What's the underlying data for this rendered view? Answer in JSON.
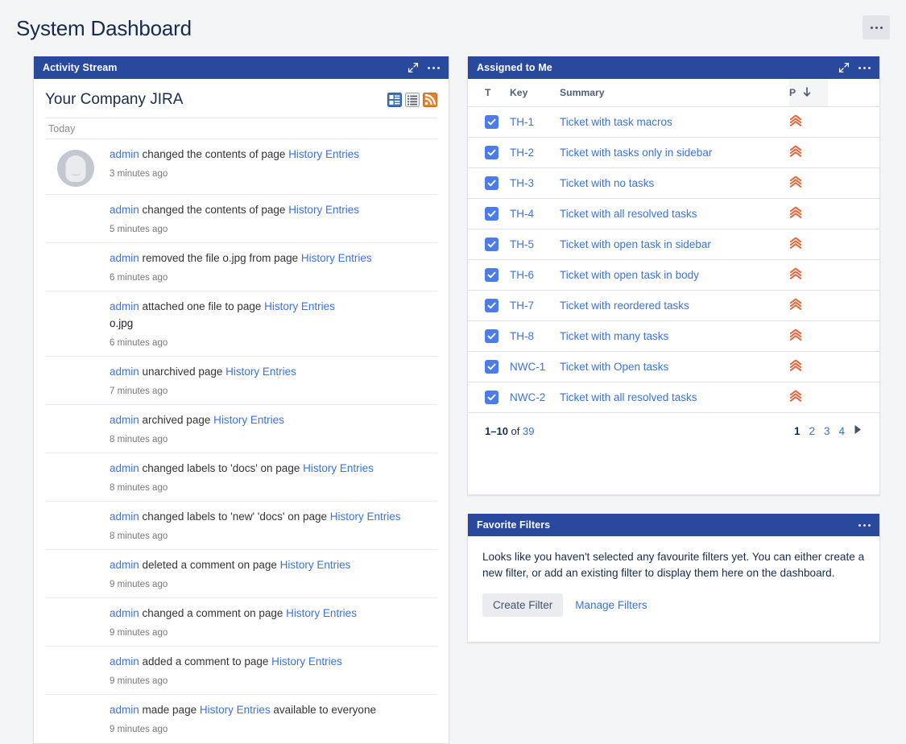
{
  "page": {
    "title": "System Dashboard",
    "menu_icon": "ellipsis-icon"
  },
  "colors": {
    "panel_header_bg": "#28499C",
    "link": "#3B73D6",
    "task_icon": "#4C7CE8",
    "priority_highest": "#E4663A",
    "page_bg": "#F4F5F7",
    "text": "#172B4D"
  },
  "activity_stream": {
    "panel_title": "Activity Stream",
    "expand_icon": "expand-icon",
    "menu_icon": "ellipsis-icon",
    "heading": "Your Company JIRA",
    "view_icons": [
      "detail-view-icon",
      "list-view-icon",
      "rss-feed-icon"
    ],
    "date_group": "Today",
    "entries": [
      {
        "has_avatar": true,
        "actor": "admin",
        "action": " changed the contents of page ",
        "target": "History Entries",
        "suffix": "",
        "attachment": "",
        "time": "3 minutes ago"
      },
      {
        "has_avatar": false,
        "actor": "admin",
        "action": " changed the contents of page ",
        "target": "History Entries",
        "suffix": "",
        "attachment": "",
        "time": "5 minutes ago"
      },
      {
        "has_avatar": false,
        "actor": "admin",
        "action": " removed the file o.jpg from page ",
        "target": "History Entries",
        "suffix": "",
        "attachment": "",
        "time": "6 minutes ago"
      },
      {
        "has_avatar": false,
        "actor": "admin",
        "action": " attached one file to page ",
        "target": "History Entries",
        "suffix": "",
        "attachment": "o.jpg",
        "time": "6 minutes ago"
      },
      {
        "has_avatar": false,
        "actor": "admin",
        "action": " unarchived page ",
        "target": "History Entries",
        "suffix": "",
        "attachment": "",
        "time": "7 minutes ago"
      },
      {
        "has_avatar": false,
        "actor": "admin",
        "action": " archived page ",
        "target": "History Entries",
        "suffix": "",
        "attachment": "",
        "time": "8 minutes ago"
      },
      {
        "has_avatar": false,
        "actor": "admin",
        "action": " changed labels to 'docs'  on page ",
        "target": "History Entries",
        "suffix": "",
        "attachment": "",
        "time": "8 minutes ago"
      },
      {
        "has_avatar": false,
        "actor": "admin",
        "action": " changed labels to 'new'  'docs'  on page ",
        "target": "History Entries",
        "suffix": "",
        "attachment": "",
        "time": "8 minutes ago"
      },
      {
        "has_avatar": false,
        "actor": "admin",
        "action": " deleted a comment on page ",
        "target": "History Entries",
        "suffix": "",
        "attachment": "",
        "time": "9 minutes ago"
      },
      {
        "has_avatar": false,
        "actor": "admin",
        "action": " changed a comment on page ",
        "target": "History Entries",
        "suffix": "",
        "attachment": "",
        "time": "9 minutes ago"
      },
      {
        "has_avatar": false,
        "actor": "admin",
        "action": " added a comment to page ",
        "target": "History Entries",
        "suffix": "",
        "attachment": "",
        "time": "9 minutes ago"
      },
      {
        "has_avatar": false,
        "actor": "admin",
        "action": " made page ",
        "target": "History Entries",
        "suffix": " available to everyone",
        "attachment": "",
        "time": "9 minutes ago"
      }
    ]
  },
  "assigned_to_me": {
    "panel_title": "Assigned to Me",
    "expand_icon": "expand-icon",
    "menu_icon": "ellipsis-icon",
    "columns": [
      "T",
      "Key",
      "Summary",
      "P",
      ""
    ],
    "sort_column": "P",
    "sort_direction": "descending",
    "rows": [
      {
        "type_icon": "task-checkbox-icon",
        "key": "TH-1",
        "summary": "Ticket with task macros",
        "priority_icon": "priority-highest-icon"
      },
      {
        "type_icon": "task-checkbox-icon",
        "key": "TH-2",
        "summary": "Ticket with tasks only in sidebar",
        "priority_icon": "priority-highest-icon"
      },
      {
        "type_icon": "task-checkbox-icon",
        "key": "TH-3",
        "summary": "Ticket with no tasks",
        "priority_icon": "priority-highest-icon"
      },
      {
        "type_icon": "task-checkbox-icon",
        "key": "TH-4",
        "summary": "Ticket with all resolved tasks",
        "priority_icon": "priority-highest-icon"
      },
      {
        "type_icon": "task-checkbox-icon",
        "key": "TH-5",
        "summary": "Ticket with open task in sidebar",
        "priority_icon": "priority-highest-icon"
      },
      {
        "type_icon": "task-checkbox-icon",
        "key": "TH-6",
        "summary": "Ticket with open task in body",
        "priority_icon": "priority-highest-icon"
      },
      {
        "type_icon": "task-checkbox-icon",
        "key": "TH-7",
        "summary": "Ticket with reordered tasks",
        "priority_icon": "priority-highest-icon"
      },
      {
        "type_icon": "task-checkbox-icon",
        "key": "TH-8",
        "summary": "Ticket with many tasks",
        "priority_icon": "priority-highest-icon"
      },
      {
        "type_icon": "task-checkbox-icon",
        "key": "NWC-1",
        "summary": "Ticket with Open tasks",
        "priority_icon": "priority-highest-icon"
      },
      {
        "type_icon": "task-checkbox-icon",
        "key": "NWC-2",
        "summary": "Ticket with all resolved tasks",
        "priority_icon": "priority-highest-icon"
      }
    ],
    "pagination": {
      "range": "1–10",
      "of_label": "of",
      "total": "39",
      "pages": [
        "1",
        "2",
        "3",
        "4"
      ],
      "current_page": "1",
      "next_icon": "next-page-icon"
    }
  },
  "favorite_filters": {
    "panel_title": "Favorite Filters",
    "menu_icon": "ellipsis-icon",
    "message": "Looks like you haven't selected any favourite filters yet. You can either create a new filter, or add an existing filter to display them here on the dashboard.",
    "create_button": "Create Filter",
    "manage_link": "Manage Filters"
  }
}
